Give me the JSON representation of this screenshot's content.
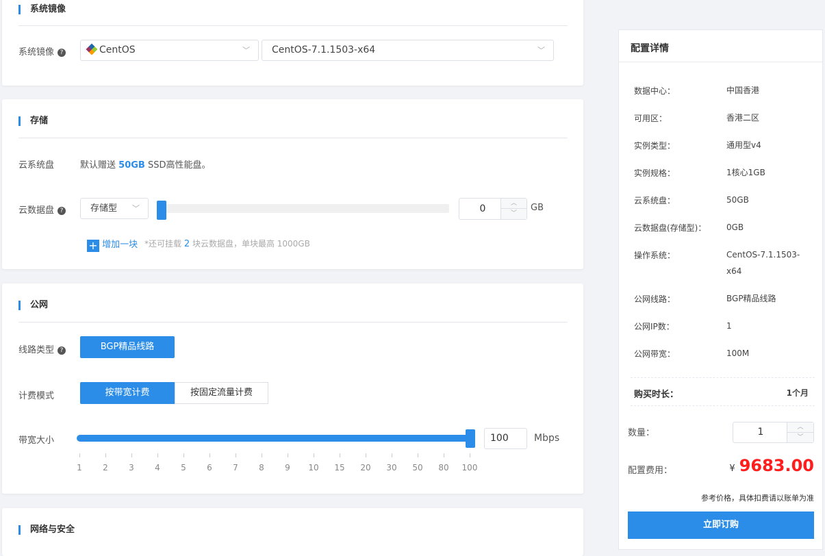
{
  "image": {
    "title": "系统镜像",
    "label": "系统镜像",
    "os": "CentOS",
    "version": "CentOS-7.1.1503-x64"
  },
  "storage": {
    "title": "存储",
    "sys_label": "云系统盘",
    "sys_prefix": "默认赠送",
    "sys_size": "50GB",
    "sys_suffix": "SSD高性能盘。",
    "data_label": "云数据盘",
    "data_type": "存储型",
    "data_value": "0",
    "data_unit": "GB",
    "data_fraction": 0,
    "add_label": "增加一块",
    "hint_prefix": "*还可挂载",
    "hint_count": "2",
    "hint_suffix": "块云数据盘，单块最高 1000GB"
  },
  "network": {
    "title": "公网",
    "line_label": "线路类型",
    "line_value": "BGP精品线路",
    "billing_label": "计费模式",
    "billing_options": [
      "按带宽计费",
      "按固定流量计费"
    ],
    "billing_selected": 0,
    "bw_label": "带宽大小",
    "bw_value": "100",
    "bw_unit": "Mbps",
    "bw_fraction": 1.0,
    "ticks": [
      "1",
      "2",
      "3",
      "4",
      "5",
      "6",
      "7",
      "8",
      "9",
      "10",
      "15",
      "20",
      "30",
      "50",
      "80",
      "100"
    ]
  },
  "security": {
    "title": "网络与安全"
  },
  "summary": {
    "title": "配置详情",
    "rows": [
      {
        "k": "数据中心：",
        "v": "中国香港"
      },
      {
        "k": "可用区：",
        "v": "香港二区"
      },
      {
        "k": "实例类型：",
        "v": "通用型v4"
      },
      {
        "k": "实例规格：",
        "v": "1核心1GB"
      },
      {
        "k": "云系统盘：",
        "v": "50GB"
      },
      {
        "k": "云数据盘(存储型)：",
        "v": "0GB"
      },
      {
        "k": "操作系统：",
        "v": "CentOS-7.1.1503-x64"
      },
      {
        "k": "公网线路：",
        "v": "BGP精品线路"
      },
      {
        "k": "公网IP数：",
        "v": "1"
      },
      {
        "k": "公网带宽：",
        "v": "100M"
      }
    ],
    "duration_label": "购买时长：",
    "duration_value": "1个月",
    "qty_label": "数量：",
    "qty_value": "1",
    "fee_label": "配置费用：",
    "currency": "¥",
    "price": "9683.00",
    "note": "参考价格，具体扣费请以账单为准",
    "order_button": "立即订购",
    "accent": "#2b8de8",
    "price_color": "#ff1e1e"
  }
}
